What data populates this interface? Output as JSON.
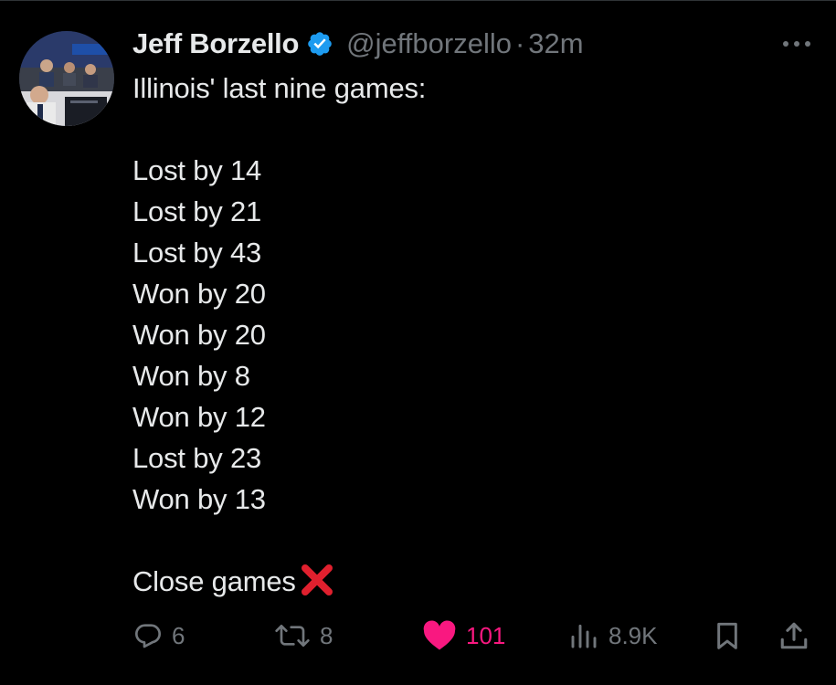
{
  "author": {
    "display_name": "Jeff Borzello",
    "handle": "@jeffborzello",
    "separator": "·",
    "time": "32m",
    "verified": true
  },
  "tweet": {
    "intro": "Illinois' last nine games:",
    "results": [
      "Lost by 14",
      "Lost by 21",
      "Lost by 43",
      "Won by 20",
      "Won by 20",
      "Won by 8",
      "Won by 12",
      "Lost by 23",
      "Won by 13"
    ],
    "closing": "Close games"
  },
  "actions": {
    "replies": "6",
    "reposts": "8",
    "likes": "101",
    "views": "8.9K"
  },
  "icons": {
    "verified": "verified-badge-icon",
    "more": "more-options-icon",
    "reply": "reply-icon",
    "repost": "repost-icon",
    "like": "heart-icon",
    "views": "views-icon",
    "bookmark": "bookmark-icon",
    "share": "share-icon",
    "cross": "cross-mark-emoji"
  },
  "colors": {
    "background": "#000000",
    "text": "#e7e9ea",
    "muted": "#71767b",
    "verified_blue": "#1d9bf0",
    "like_pink": "#f91880",
    "cross_red": "#e0202e"
  }
}
